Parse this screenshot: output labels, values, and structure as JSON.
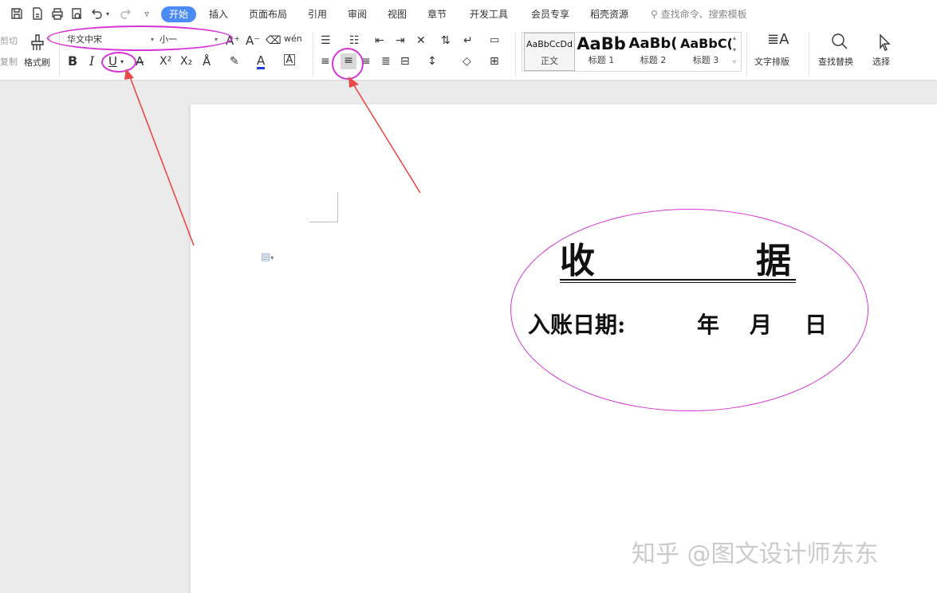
{
  "toolbar": {
    "tabs": [
      "开始",
      "插入",
      "页面布局",
      "引用",
      "审阅",
      "视图",
      "章节",
      "开发工具",
      "会员专享",
      "稻壳资源"
    ],
    "search_placeholder": "查找命令、搜索模板"
  },
  "ribbon": {
    "cut_label": "剪切",
    "copy_label": "复制",
    "format_painter_label": "格式刷",
    "font_name": "华文中宋",
    "font_size": "小一",
    "bold": "B",
    "italic": "I",
    "underline": "U",
    "superscript": "X²",
    "subscript": "X₂",
    "font_color_glyph": "A",
    "styles": [
      {
        "sample": "AaBbCcDd",
        "name": "正文"
      },
      {
        "sample": "AaBb",
        "name": "标题 1"
      },
      {
        "sample": "AaBb(",
        "name": "标题 2"
      },
      {
        "sample": "AaBbC(",
        "name": "标题 3"
      }
    ],
    "text_layout_label": "文字排版",
    "find_replace_label": "查找替换",
    "select_label": "选择"
  },
  "document": {
    "title_char_1": "收",
    "title_char_2": "据",
    "date_label": "入账日期:",
    "year": "年",
    "month": "月",
    "day": "日"
  },
  "watermark": "知乎 @图文设计师东东",
  "colors": {
    "accent": "#4a8bf5",
    "annotation": "#d633d6",
    "arrow": "#e84a4a"
  }
}
